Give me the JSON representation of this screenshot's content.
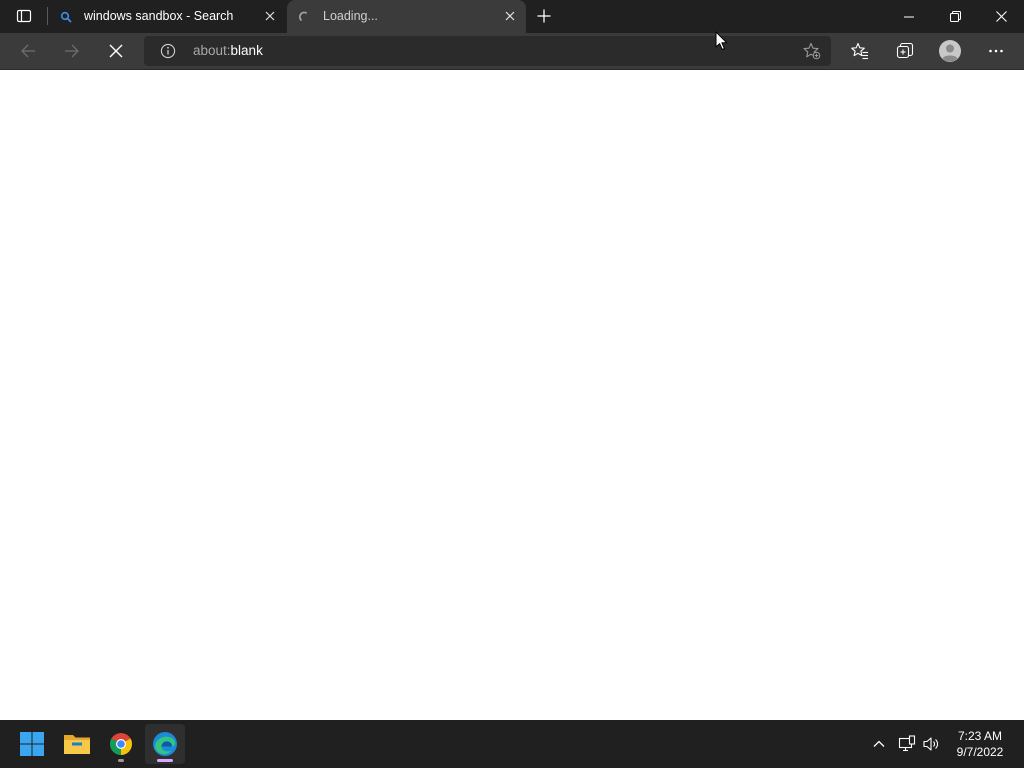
{
  "browser": {
    "tabs": [
      {
        "title": "windows sandbox - Search",
        "icon": "search-icon",
        "active": false
      },
      {
        "title": "Loading...",
        "icon": "loading-spinner-icon",
        "active": true
      }
    ],
    "address_bar": {
      "scheme": "about:",
      "path": "blank"
    },
    "toolbar_icons": [
      "back-icon",
      "forward-icon",
      "stop-icon",
      "site-info-icon",
      "add-favorite-icon",
      "favorites-icon",
      "collections-icon",
      "profile-icon",
      "more-icon"
    ]
  },
  "taskbar": {
    "apps": [
      "start-icon",
      "file-explorer-icon",
      "chrome-icon",
      "edge-icon"
    ],
    "clock": {
      "time": "7:23 AM",
      "date": "9/7/2022"
    }
  },
  "colors": {
    "tabbar_bg": "#202020",
    "toolbar_bg": "#3b3b3b",
    "address_bg": "#2b2b2b",
    "accent_search": "#3b8eea",
    "edge_indicator": "#d9a8ff"
  }
}
